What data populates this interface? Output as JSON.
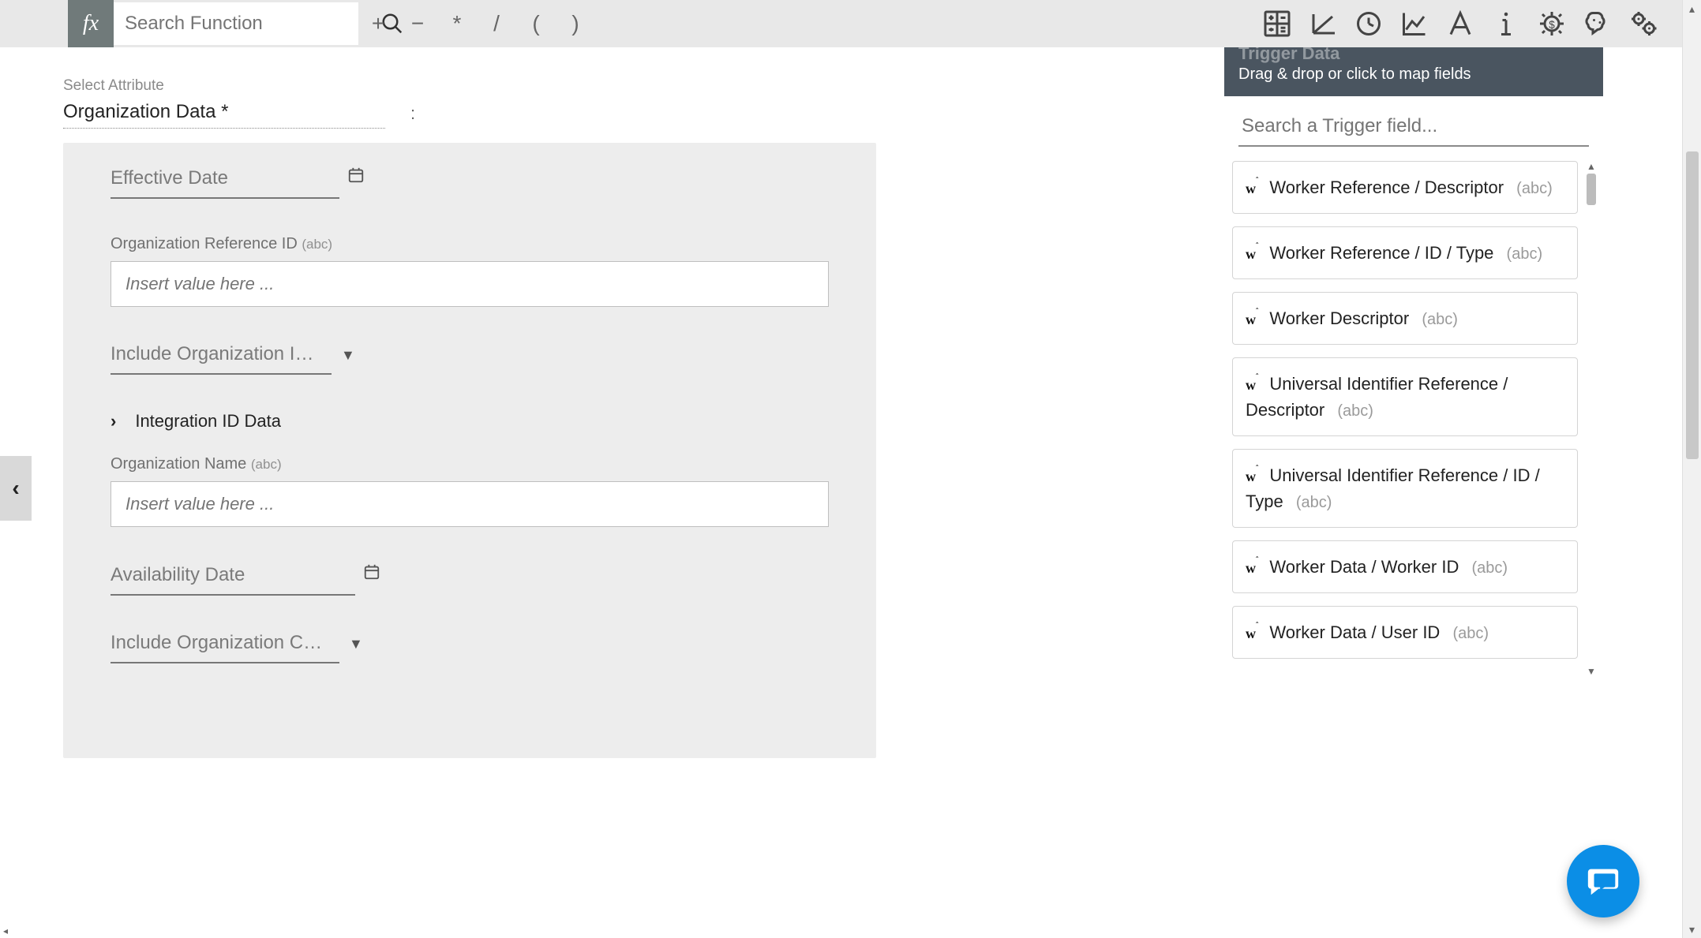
{
  "toolbar": {
    "fx": "fx",
    "search_placeholder": "Search Function",
    "ops": {
      "plus": "+",
      "minus": "−",
      "star": "*",
      "slash": "/",
      "lparen": "(",
      "rparen": ")"
    }
  },
  "attribute": {
    "select_label": "Select Attribute",
    "name": "Organization Data *",
    "colon": ":"
  },
  "panel": {
    "effective_date": "Effective Date",
    "org_ref_id_label": "Organization Reference ID",
    "org_ref_id_type": "(abc)",
    "input_placeholder": "Insert value here ...",
    "include_org_i": "Include Organization I…",
    "integration_id_data": "Integration ID Data",
    "org_name_label": "Organization Name",
    "org_name_type": "(abc)",
    "availability_date": "Availability Date",
    "include_org_c": "Include Organization C…"
  },
  "trigger": {
    "title": "Trigger Data",
    "subtitle": "Drag & drop or click to map fields",
    "search_placeholder": "Search a Trigger field...",
    "abc": "(abc)",
    "fields": [
      "Worker Reference / Descriptor",
      "Worker Reference / ID / Type",
      "Worker Descriptor",
      "Universal Identifier Reference / Descriptor",
      "Universal Identifier Reference / ID / Type",
      "Worker Data / Worker ID",
      "Worker Data / User ID"
    ]
  }
}
